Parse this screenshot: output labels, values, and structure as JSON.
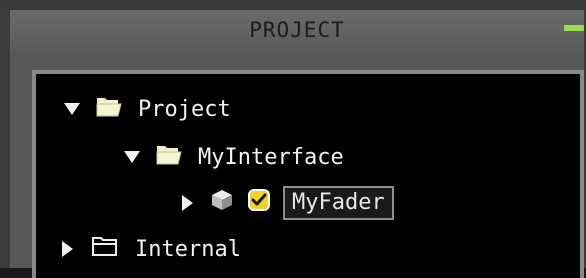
{
  "window": {
    "title": "PROJECT"
  },
  "tree": {
    "items": [
      {
        "label": "Project",
        "icon": "open-folder-icon",
        "expanded": true
      },
      {
        "label": "MyInterface",
        "icon": "open-folder-icon",
        "expanded": true
      },
      {
        "label": "MyFader",
        "icon": "cube-icon",
        "checkbox": true,
        "checked": true,
        "selected": true,
        "expanded": false
      },
      {
        "label": "Internal",
        "icon": "folder-outline-icon",
        "expanded": false
      }
    ]
  },
  "colors": {
    "folder": "#f1f0c8",
    "checkbox_fill": "#f4d02a",
    "accent": "#9adf4e",
    "panel_background": "#000000",
    "window_background": "#585858"
  }
}
